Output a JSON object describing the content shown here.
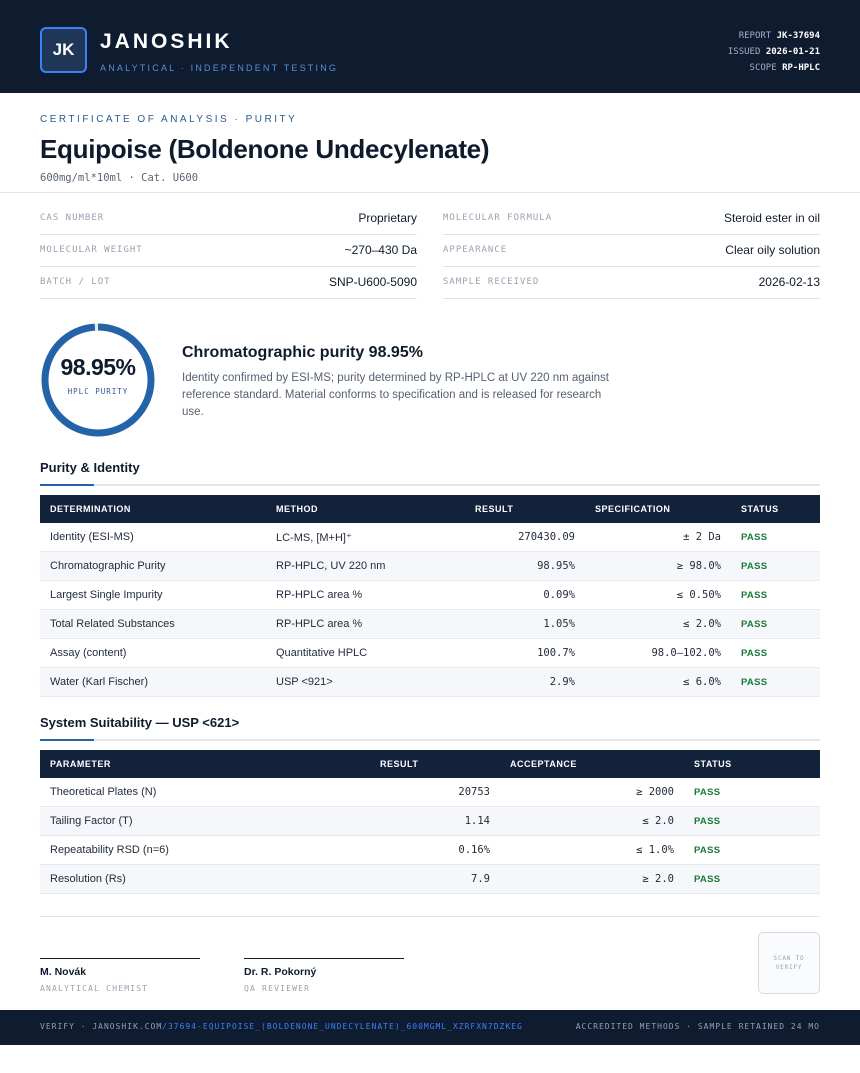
{
  "header": {
    "logo_initials": "JK",
    "brand_name": "JANOSHIK",
    "tagline": "ANALYTICAL · INDEPENDENT TESTING",
    "report_label": "REPORT",
    "report_value": "JK-37694",
    "issued_label": "ISSUED",
    "issued_value": "2026-01-21",
    "scope_label": "SCOPE",
    "scope_value": "RP-HPLC"
  },
  "doc": {
    "kicker": "CERTIFICATE OF ANALYSIS · PURITY",
    "title": "Equipoise (Boldenone Undecylenate)",
    "subtitle": "600mg/ml*10ml  ·  Cat. U600"
  },
  "info": [
    {
      "label": "CAS NUMBER",
      "value": "Proprietary"
    },
    {
      "label": "MOLECULAR FORMULA",
      "value": "Steroid ester in oil"
    },
    {
      "label": "MOLECULAR WEIGHT",
      "value": "~270–430 Da"
    },
    {
      "label": "APPEARANCE",
      "value": "Clear oily solution"
    },
    {
      "label": "BATCH / LOT",
      "value": "SNP-U600-5090"
    },
    {
      "label": "SAMPLE RECEIVED",
      "value": "2026-02-13"
    }
  ],
  "purity": {
    "value": "98.95%",
    "percent": 98.95,
    "label": "HPLC PURITY",
    "headline": "Chromatographic purity 98.95%",
    "description": "Identity confirmed by ESI-MS; purity determined by RP-HPLC at UV 220 nm against reference standard. Material conforms to specification and is released for research use.",
    "ring_color": "#2563a8"
  },
  "identity_section": {
    "title": "Purity & Identity",
    "headers": [
      "DETERMINATION",
      "METHOD",
      "RESULT",
      "SPECIFICATION",
      "STATUS"
    ],
    "rows": [
      {
        "determination": "Identity (ESI-MS)",
        "method": "LC-MS, [M+H]⁺",
        "result": "270430.09",
        "spec": "± 2 Da",
        "status": "PASS"
      },
      {
        "determination": "Chromatographic Purity",
        "method": "RP-HPLC, UV 220 nm",
        "result": "98.95%",
        "spec": "≥ 98.0%",
        "status": "PASS"
      },
      {
        "determination": "Largest Single Impurity",
        "method": "RP-HPLC area %",
        "result": "0.09%",
        "spec": "≤ 0.50%",
        "status": "PASS"
      },
      {
        "determination": "Total Related Substances",
        "method": "RP-HPLC area %",
        "result": "1.05%",
        "spec": "≤ 2.0%",
        "status": "PASS"
      },
      {
        "determination": "Assay (content)",
        "method": "Quantitative HPLC",
        "result": "100.7%",
        "spec": "98.0–102.0%",
        "status": "PASS"
      },
      {
        "determination": "Water (Karl Fischer)",
        "method": "USP <921>",
        "result": "2.9%",
        "spec": "≤ 6.0%",
        "status": "PASS"
      }
    ]
  },
  "suitability_section": {
    "title": "System Suitability — USP <621>",
    "headers": [
      "PARAMETER",
      "RESULT",
      "ACCEPTANCE",
      "STATUS"
    ],
    "rows": [
      {
        "parameter": "Theoretical Plates (N)",
        "result": "20753",
        "acceptance": "≥ 2000",
        "status": "PASS"
      },
      {
        "parameter": "Tailing Factor (T)",
        "result": "1.14",
        "acceptance": "≤ 2.0",
        "status": "PASS"
      },
      {
        "parameter": "Repeatability RSD (n=6)",
        "result": "0.16%",
        "acceptance": "≤ 1.0%",
        "status": "PASS"
      },
      {
        "parameter": "Resolution (Rs)",
        "result": "7.9",
        "acceptance": "≥ 2.0",
        "status": "PASS"
      }
    ]
  },
  "signatures": [
    {
      "name": "M. Novák",
      "role": "ANALYTICAL CHEMIST"
    },
    {
      "name": "Dr. R. Pokorný",
      "role": "QA REVIEWER"
    }
  ],
  "qr": {
    "text": "SCAN TO VERIFY"
  },
  "footer": {
    "verify_prefix": "VERIFY · JANOSHIK.COM",
    "verify_link": "/37694-EQUIPOISE_(BOLDENONE_UNDECYLENATE)_600MGML_XZRFXN7DZKEG",
    "right_text": "ACCREDITED METHODS · SAMPLE RETAINED 24 MO"
  }
}
